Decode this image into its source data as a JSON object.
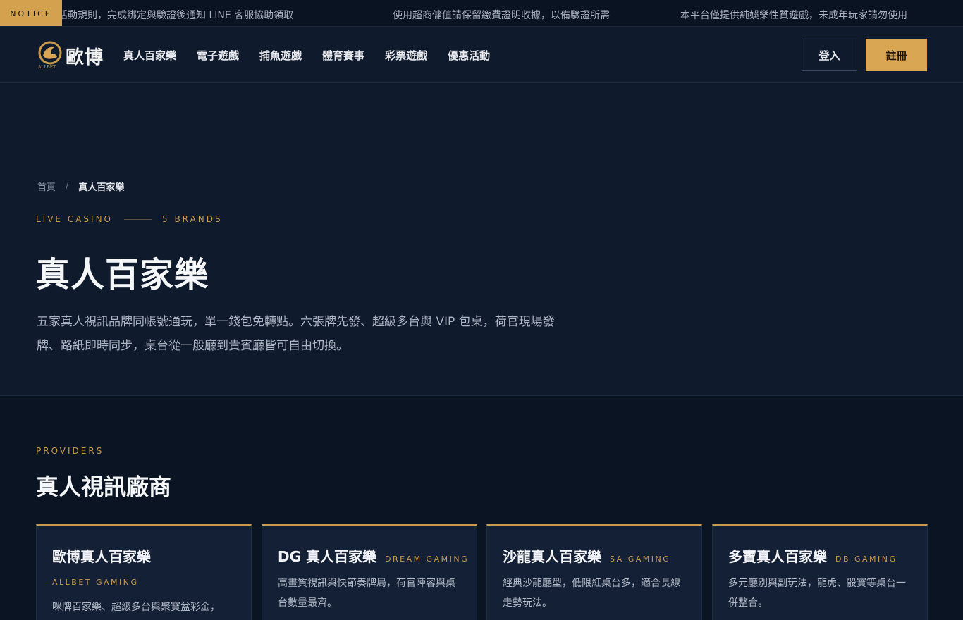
{
  "notice": {
    "tag": "NOTICE",
    "messages": [
      "先詳閱活動規則，完成綁定與驗證後通知 LINE 客服協助領取",
      "使用超商儲值請保留繳費證明收據，以備驗證所需",
      "本平台僅提供純娛樂性質遊戲，未成年玩家請勿使用"
    ]
  },
  "header": {
    "logo_text": "歐博",
    "logo_sub": "ALLBET",
    "nav": [
      "真人百家樂",
      "電子遊戲",
      "捕魚遊戲",
      "體育賽事",
      "彩票遊戲",
      "優惠活動"
    ],
    "login_label": "登入",
    "register_label": "註冊"
  },
  "hero": {
    "breadcrumb": {
      "home": "首頁",
      "separator": "/",
      "current": "真人百家樂"
    },
    "eyebrow_left": "LIVE CASINO",
    "eyebrow_right": "5 BRANDS",
    "title": "真人百家樂",
    "description": "五家真人視訊品牌同帳號通玩，單一錢包免轉點。六張牌先發、超級多台與 VIP 包桌，荷官現場發牌、路紙即時同步，桌台從一般廳到貴賓廳皆可自由切換。"
  },
  "providers": {
    "eyebrow": "PROVIDERS",
    "title": "真人視訊廠商",
    "cards": [
      {
        "name": "歐博真人百家樂",
        "brand": "ALLBET GAMING",
        "brand_layout": "block",
        "description": "咪牌百家樂、超級多台與聚寶盆彩金，"
      },
      {
        "name": "DG 真人百家樂",
        "brand": "DREAM GAMING",
        "brand_layout": "inline",
        "description": "高畫質視訊與快節奏牌局，荷官陣容與桌台數量最齊。"
      },
      {
        "name": "沙龍真人百家樂",
        "brand": "SA GAMING",
        "brand_layout": "inline",
        "description": "經典沙龍廳型，低限紅桌台多，適合長線走勢玩法。"
      },
      {
        "name": "多寶真人百家樂",
        "brand": "DB GAMING",
        "brand_layout": "inline",
        "description": "多元廳別與副玩法，龍虎、骰寶等桌台一併整合。"
      }
    ]
  },
  "colors": {
    "accent": "#d9a653",
    "background": "#0c1626",
    "header_bg": "#0f1a2c",
    "card_bg": "#142036"
  }
}
